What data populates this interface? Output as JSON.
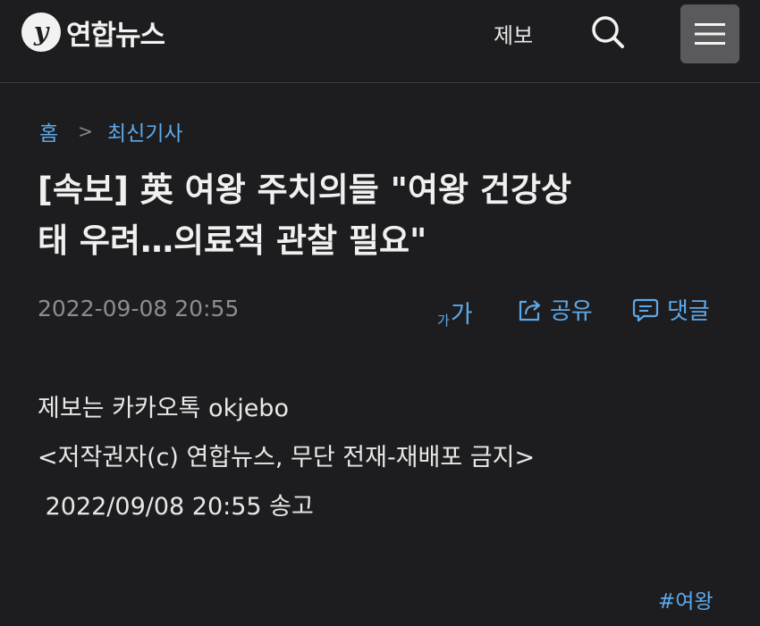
{
  "header": {
    "logo_text": "연합뉴스",
    "tip_label": "제보"
  },
  "breadcrumb": {
    "home": "홈",
    "separator": ">",
    "section": "최신기사"
  },
  "article": {
    "headline_line1": "[속보] 英 여왕 주치의들 \"여왕 건강상",
    "headline_line2": "태 우려…의료적 관찰 필요\"",
    "date": "2022-09-08 20:55",
    "font_size_small": "가",
    "font_size_big": "가",
    "share_label": "공유",
    "comment_label": "댓글",
    "body_lines": [
      "제보는 카카오톡 okjebo",
      "<저작권자(c) 연합뉴스, 무단 전재-재배포 금지>",
      " 2022/09/08 20:55 송고"
    ],
    "tag": "#여왕"
  },
  "colors": {
    "background": "#1d1d1f",
    "accent": "#5ea8e8",
    "muted": "#8d8d90"
  }
}
